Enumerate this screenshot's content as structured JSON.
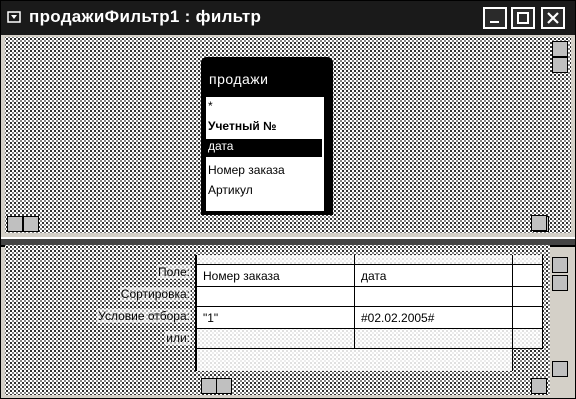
{
  "window": {
    "title": "продажиФильтр1 : фильтр",
    "buttons": [
      "minimize",
      "maximize",
      "close"
    ]
  },
  "table_box": {
    "title": "продажи",
    "fields": [
      "*",
      "Учетный №",
      "дата",
      "Номер заказа",
      "Артикул"
    ],
    "selected_index": 2
  },
  "grid": {
    "row_labels": [
      "Поле:",
      "Сортировка:",
      "Условие отбора:",
      "или:"
    ],
    "columns": [
      {
        "field": "Номер заказа",
        "sort": "",
        "criteria": "\"1\"",
        "or": ""
      },
      {
        "field": "дата",
        "sort": "",
        "criteria": "#02.02.2005#",
        "or": ""
      },
      {
        "field": "",
        "sort": "",
        "criteria": "",
        "or": ""
      }
    ]
  }
}
